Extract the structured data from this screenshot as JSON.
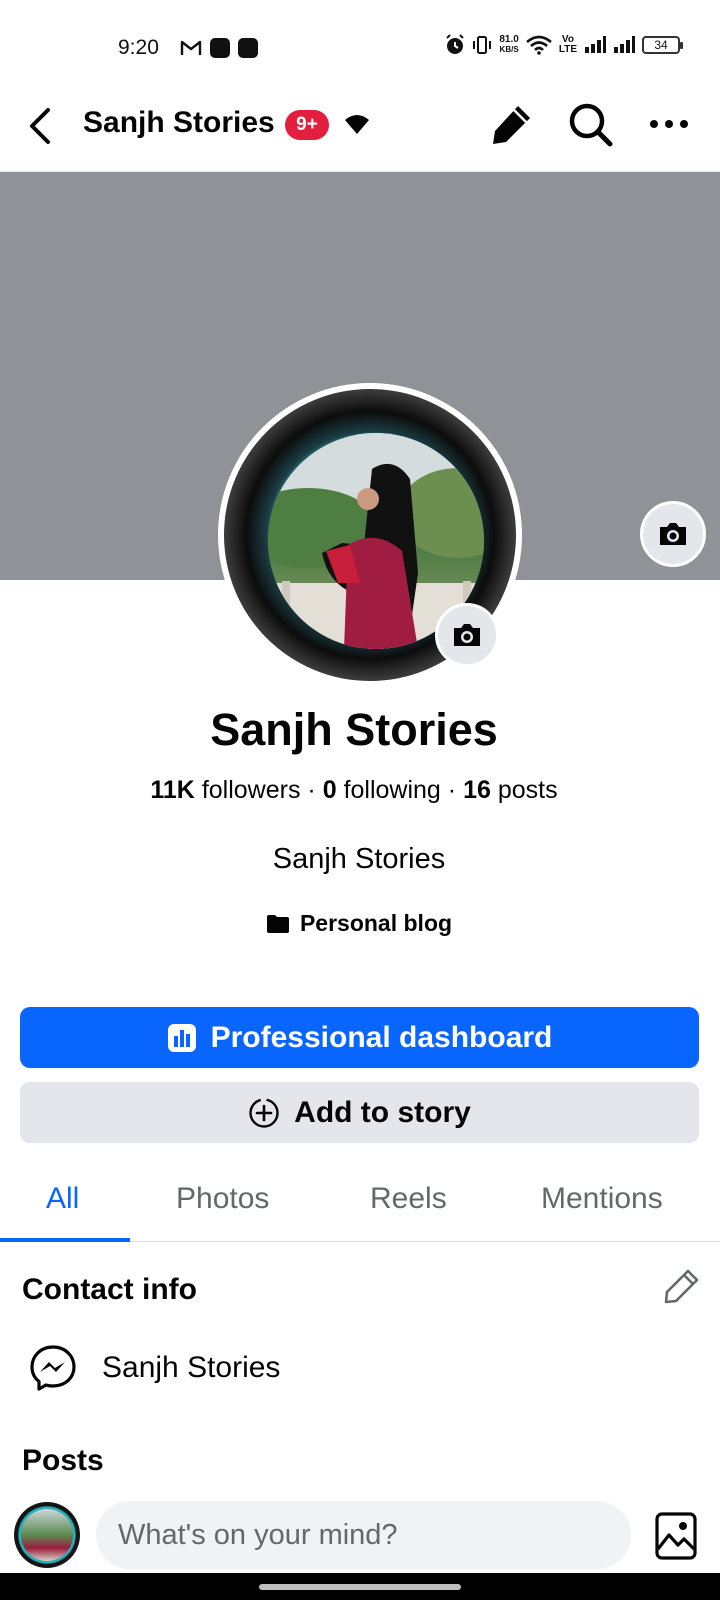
{
  "status_bar": {
    "time": "9:20",
    "net_speed_value": "81.0",
    "net_speed_unit": "KB/S",
    "volte": "Vo",
    "lte": "LTE",
    "battery": "34"
  },
  "app_bar": {
    "title": "Sanjh Stories",
    "badge": "9+",
    "icons": [
      "back-arrow-icon",
      "caret-down-icon",
      "pencil-icon",
      "search-icon",
      "more-icon"
    ]
  },
  "profile": {
    "name": "Sanjh Stories",
    "followers_count": "11K",
    "followers_label": "followers",
    "following_count": "0",
    "following_label": "following",
    "posts_count": "16",
    "posts_label": "posts",
    "separator": "·",
    "bio": "Sanjh Stories",
    "category": "Personal blog"
  },
  "actions": {
    "primary_label": "Professional dashboard",
    "secondary_label": "Add to story"
  },
  "tabs": [
    {
      "label": "All",
      "active": true
    },
    {
      "label": "Photos",
      "active": false
    },
    {
      "label": "Reels",
      "active": false
    },
    {
      "label": "Mentions",
      "active": false
    }
  ],
  "contact_info": {
    "title": "Contact info",
    "messenger_label": "Sanjh Stories"
  },
  "posts": {
    "title": "Posts",
    "composer_placeholder": "What's on your mind?"
  },
  "colors": {
    "accent": "#0866ff",
    "badge": "#e41e3f",
    "cover": "#8f9296",
    "secondary_button": "#e4e6eb"
  }
}
